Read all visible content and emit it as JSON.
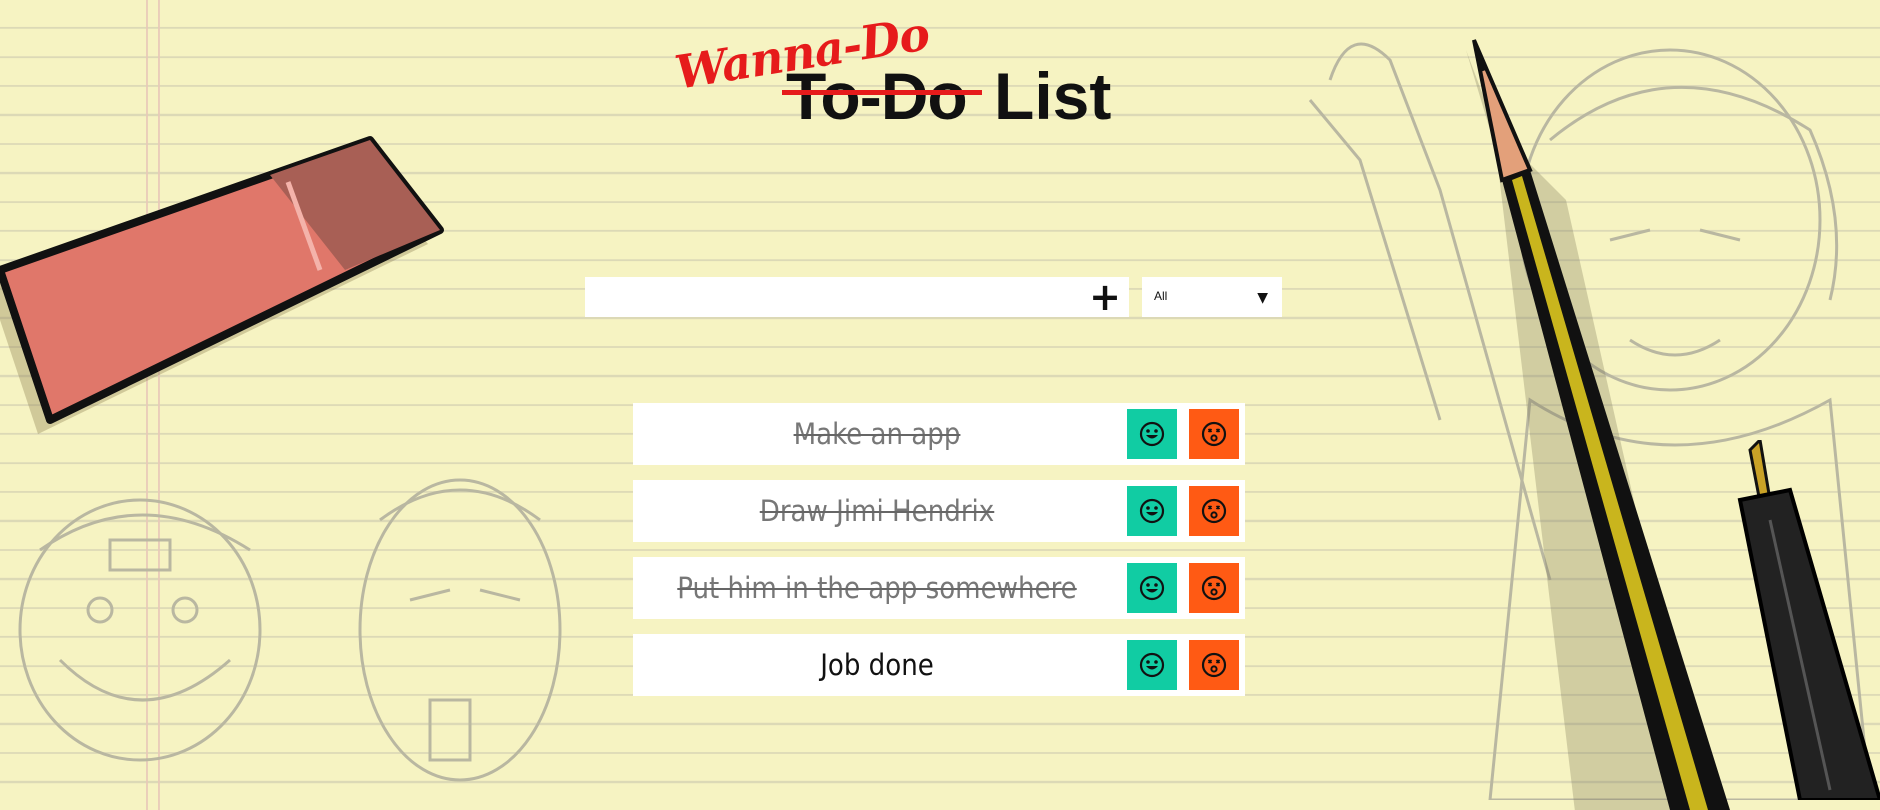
{
  "header": {
    "correction": "Wanna-Do",
    "struck_word": "To-Do",
    "word": "List"
  },
  "form": {
    "input_value": "",
    "add_symbol": "+",
    "filter": {
      "selected": "All",
      "arrow": "▼"
    }
  },
  "todos": [
    {
      "text": "Make an app",
      "completed": true
    },
    {
      "text": "Draw Jimi Hendrix",
      "completed": true
    },
    {
      "text": "Put him in the app somewhere",
      "completed": true
    },
    {
      "text": "Job done",
      "completed": false
    }
  ],
  "colors": {
    "paper": "#f6f3c2",
    "complete_button": "#11cca3",
    "delete_button": "#ff5a14",
    "accent_red": "#e61b1b"
  },
  "icons": {
    "complete": "smile-face-icon",
    "delete": "dizzy-face-icon",
    "add": "plus-icon",
    "dropdown": "caret-down-icon"
  }
}
